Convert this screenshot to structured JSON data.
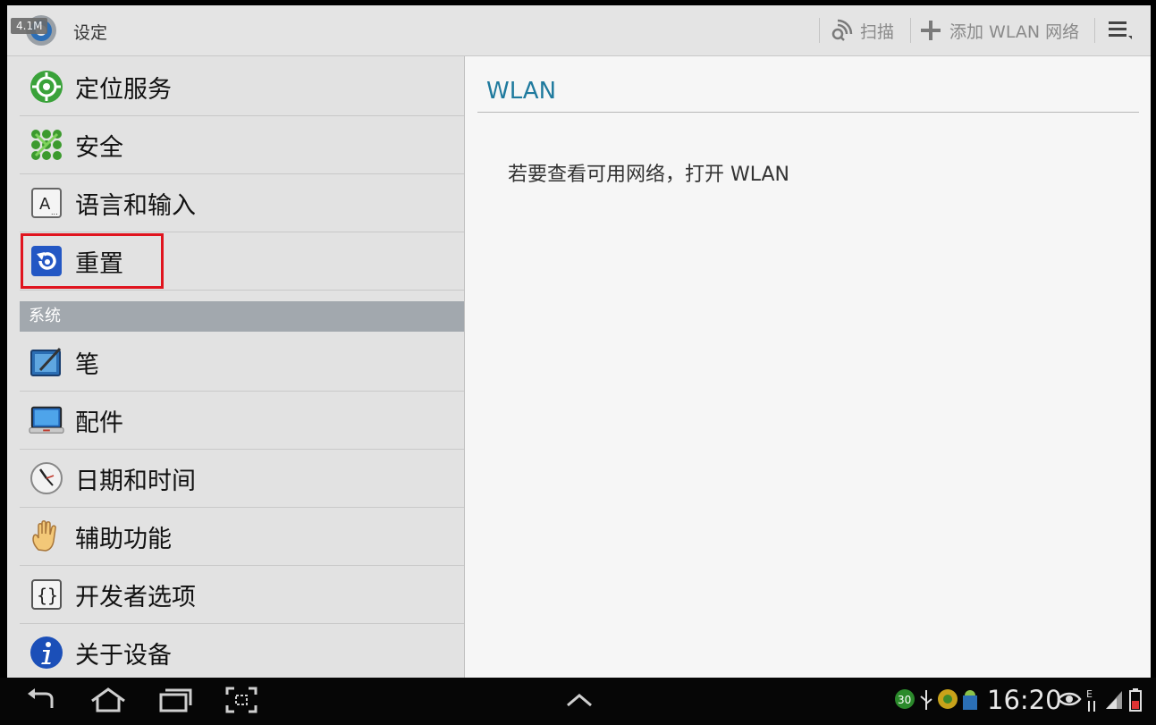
{
  "actionbar": {
    "title": "设定",
    "data_badge": "4.1M",
    "scan_label": "扫描",
    "add_wlan_label": "添加 WLAN 网络"
  },
  "sidebar": {
    "items_top": [
      {
        "label": "定位服务",
        "icon": "location-icon"
      },
      {
        "label": "安全",
        "icon": "security-icon"
      },
      {
        "label": "语言和输入",
        "icon": "language-icon"
      },
      {
        "label": "重置",
        "icon": "reset-icon"
      }
    ],
    "section_header": "系统",
    "items_system": [
      {
        "label": "笔",
        "icon": "pen-icon"
      },
      {
        "label": "配件",
        "icon": "accessory-icon"
      },
      {
        "label": "日期和时间",
        "icon": "clock-icon"
      },
      {
        "label": "辅助功能",
        "icon": "hand-icon"
      },
      {
        "label": "开发者选项",
        "icon": "braces-icon"
      },
      {
        "label": "关于设备",
        "icon": "info-icon"
      }
    ]
  },
  "detail": {
    "title": "WLAN",
    "message": "若要查看可用网络，打开 WLAN"
  },
  "statusbar": {
    "time": "16:20",
    "notification_count": "30"
  },
  "colors": {
    "highlight": "#e0141e",
    "pane_title": "#1f7a9e",
    "section_bg": "#a2a8ae"
  }
}
